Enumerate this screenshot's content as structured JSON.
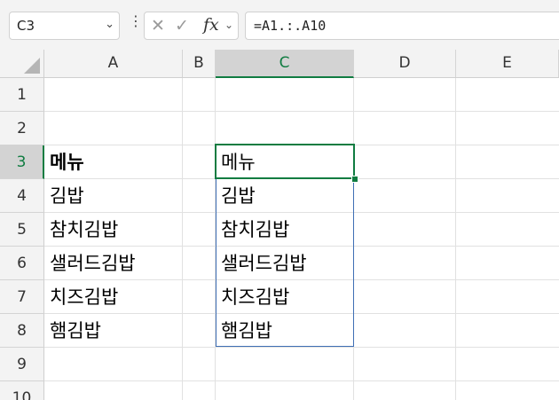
{
  "name_box": {
    "value": "C3"
  },
  "formula_bar": {
    "formula": "=A1.:.A10"
  },
  "columns": [
    {
      "letter": "A",
      "selected": false
    },
    {
      "letter": "B",
      "selected": false
    },
    {
      "letter": "C",
      "selected": true
    },
    {
      "letter": "D",
      "selected": false
    },
    {
      "letter": "E",
      "selected": false
    }
  ],
  "rows": [
    {
      "number": "1",
      "selected": false
    },
    {
      "number": "2",
      "selected": false
    },
    {
      "number": "3",
      "selected": true
    },
    {
      "number": "4",
      "selected": false
    },
    {
      "number": "5",
      "selected": false
    },
    {
      "number": "6",
      "selected": false
    },
    {
      "number": "7",
      "selected": false
    },
    {
      "number": "8",
      "selected": false
    },
    {
      "number": "9",
      "selected": false
    },
    {
      "number": "10",
      "selected": false
    }
  ],
  "cells": {
    "A3": "메뉴",
    "A4": "김밥",
    "A5": "참치김밥",
    "A6": "샐러드김밥",
    "A7": "치즈김밥",
    "A8": "햄김밥",
    "C3": "메뉴",
    "C4": "김밥",
    "C5": "참치김밥",
    "C6": "샐러드김밥",
    "C7": "치즈김밥",
    "C8": "햄김밥"
  },
  "selection": {
    "active_cell": "C3",
    "accent_color": "#107c41",
    "spill_border_color": "#3f6fb5"
  }
}
